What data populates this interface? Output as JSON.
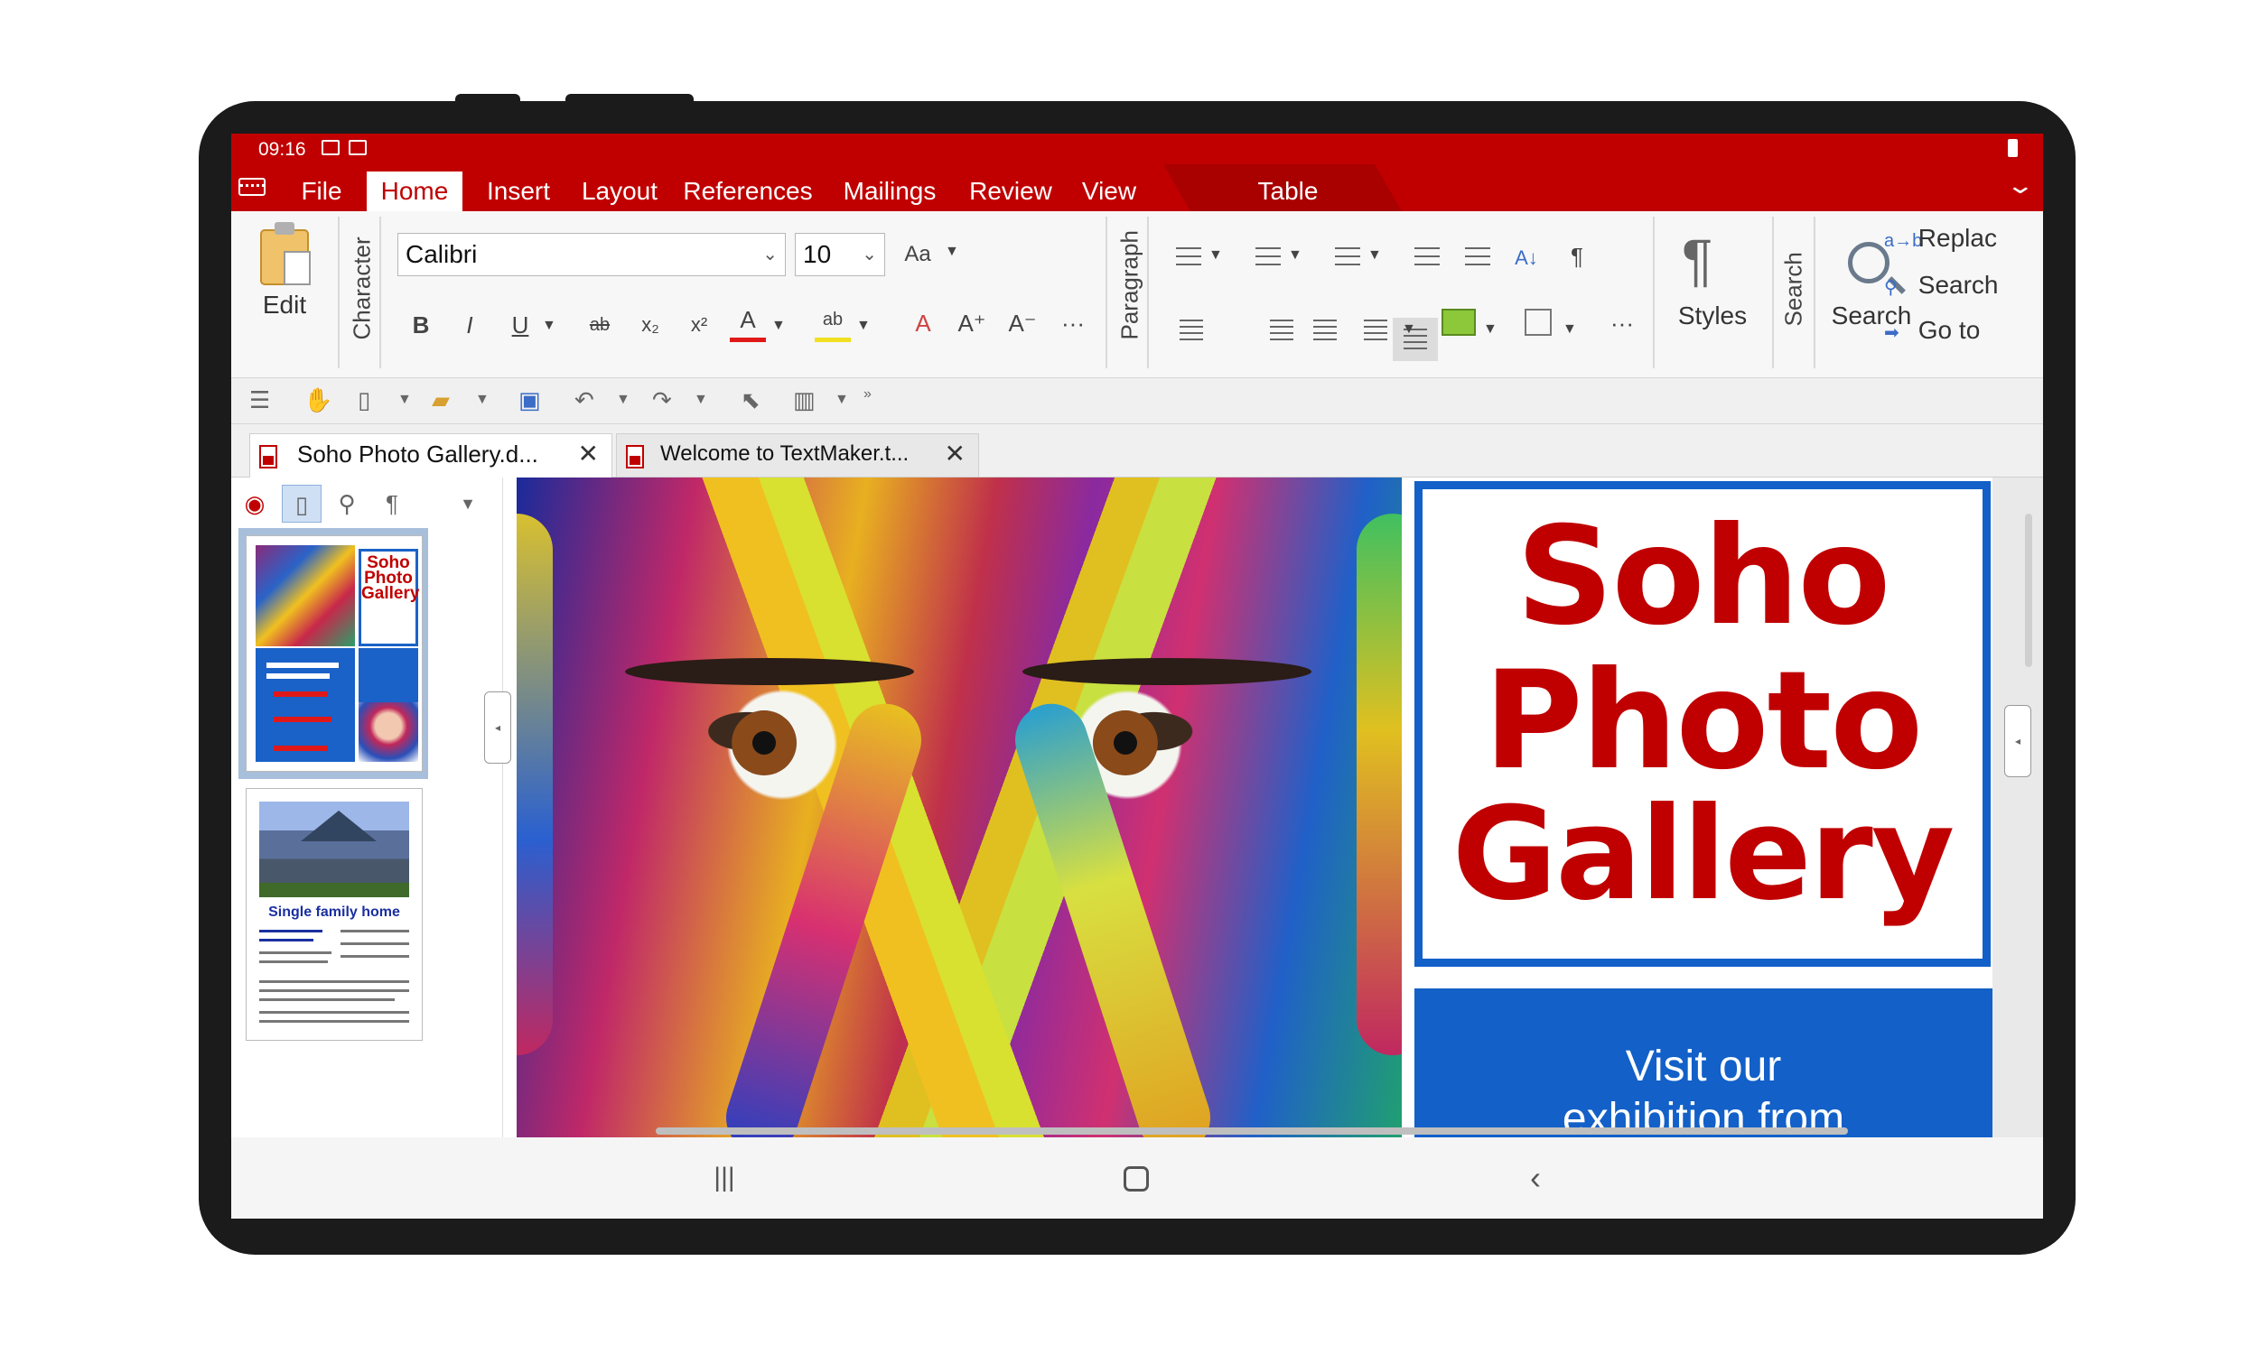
{
  "status_bar": {
    "time": "09:16"
  },
  "menu": {
    "items": [
      "File",
      "Home",
      "Insert",
      "Layout",
      "References",
      "Mailings",
      "Review",
      "View"
    ],
    "context_tab": "Table",
    "active": "Home"
  },
  "ribbon": {
    "edit_label": "Edit",
    "character_label": "Character",
    "paragraph_label": "Paragraph",
    "search_group_label": "Search",
    "font_name": "Calibri",
    "font_size": "10",
    "styles_label": "Styles",
    "search_label": "Search",
    "right_items": [
      "Replac",
      "Search",
      "Go to"
    ]
  },
  "tabs": [
    {
      "label": "Soho Photo Gallery.d...",
      "active": true
    },
    {
      "label": "Welcome to TextMaker.t...",
      "active": false
    }
  ],
  "thumbnails": {
    "page1_title": [
      "Soho",
      "Photo",
      "Gallery"
    ],
    "page2_caption": "Single family home"
  },
  "document": {
    "title_lines": [
      "Soho",
      "Photo",
      "Gallery"
    ],
    "blue_text_lines": [
      "Visit our",
      "exhibition from"
    ]
  },
  "colors": {
    "brand_red": "#c00000",
    "accent_blue": "#1260c8"
  },
  "icons": [
    "keyboard-icon",
    "image-icon",
    "mail-icon",
    "battery-icon",
    "paste-icon",
    "bold-icon",
    "italic-icon",
    "underline-icon",
    "strikethrough-icon",
    "subscript-icon",
    "superscript-icon",
    "font-color-icon",
    "highlight-icon",
    "clear-format-icon",
    "grow-font-icon",
    "shrink-font-icon",
    "bullets-icon",
    "numbering-icon",
    "multilevel-icon",
    "indent-icon",
    "outdent-icon",
    "sort-icon",
    "pilcrow-icon",
    "align-left-icon",
    "align-center-icon",
    "align-right-icon",
    "justify-icon",
    "line-spacing-icon",
    "shading-icon",
    "borders-icon",
    "styles-icon",
    "search-icon",
    "replace-icon",
    "goto-icon"
  ]
}
